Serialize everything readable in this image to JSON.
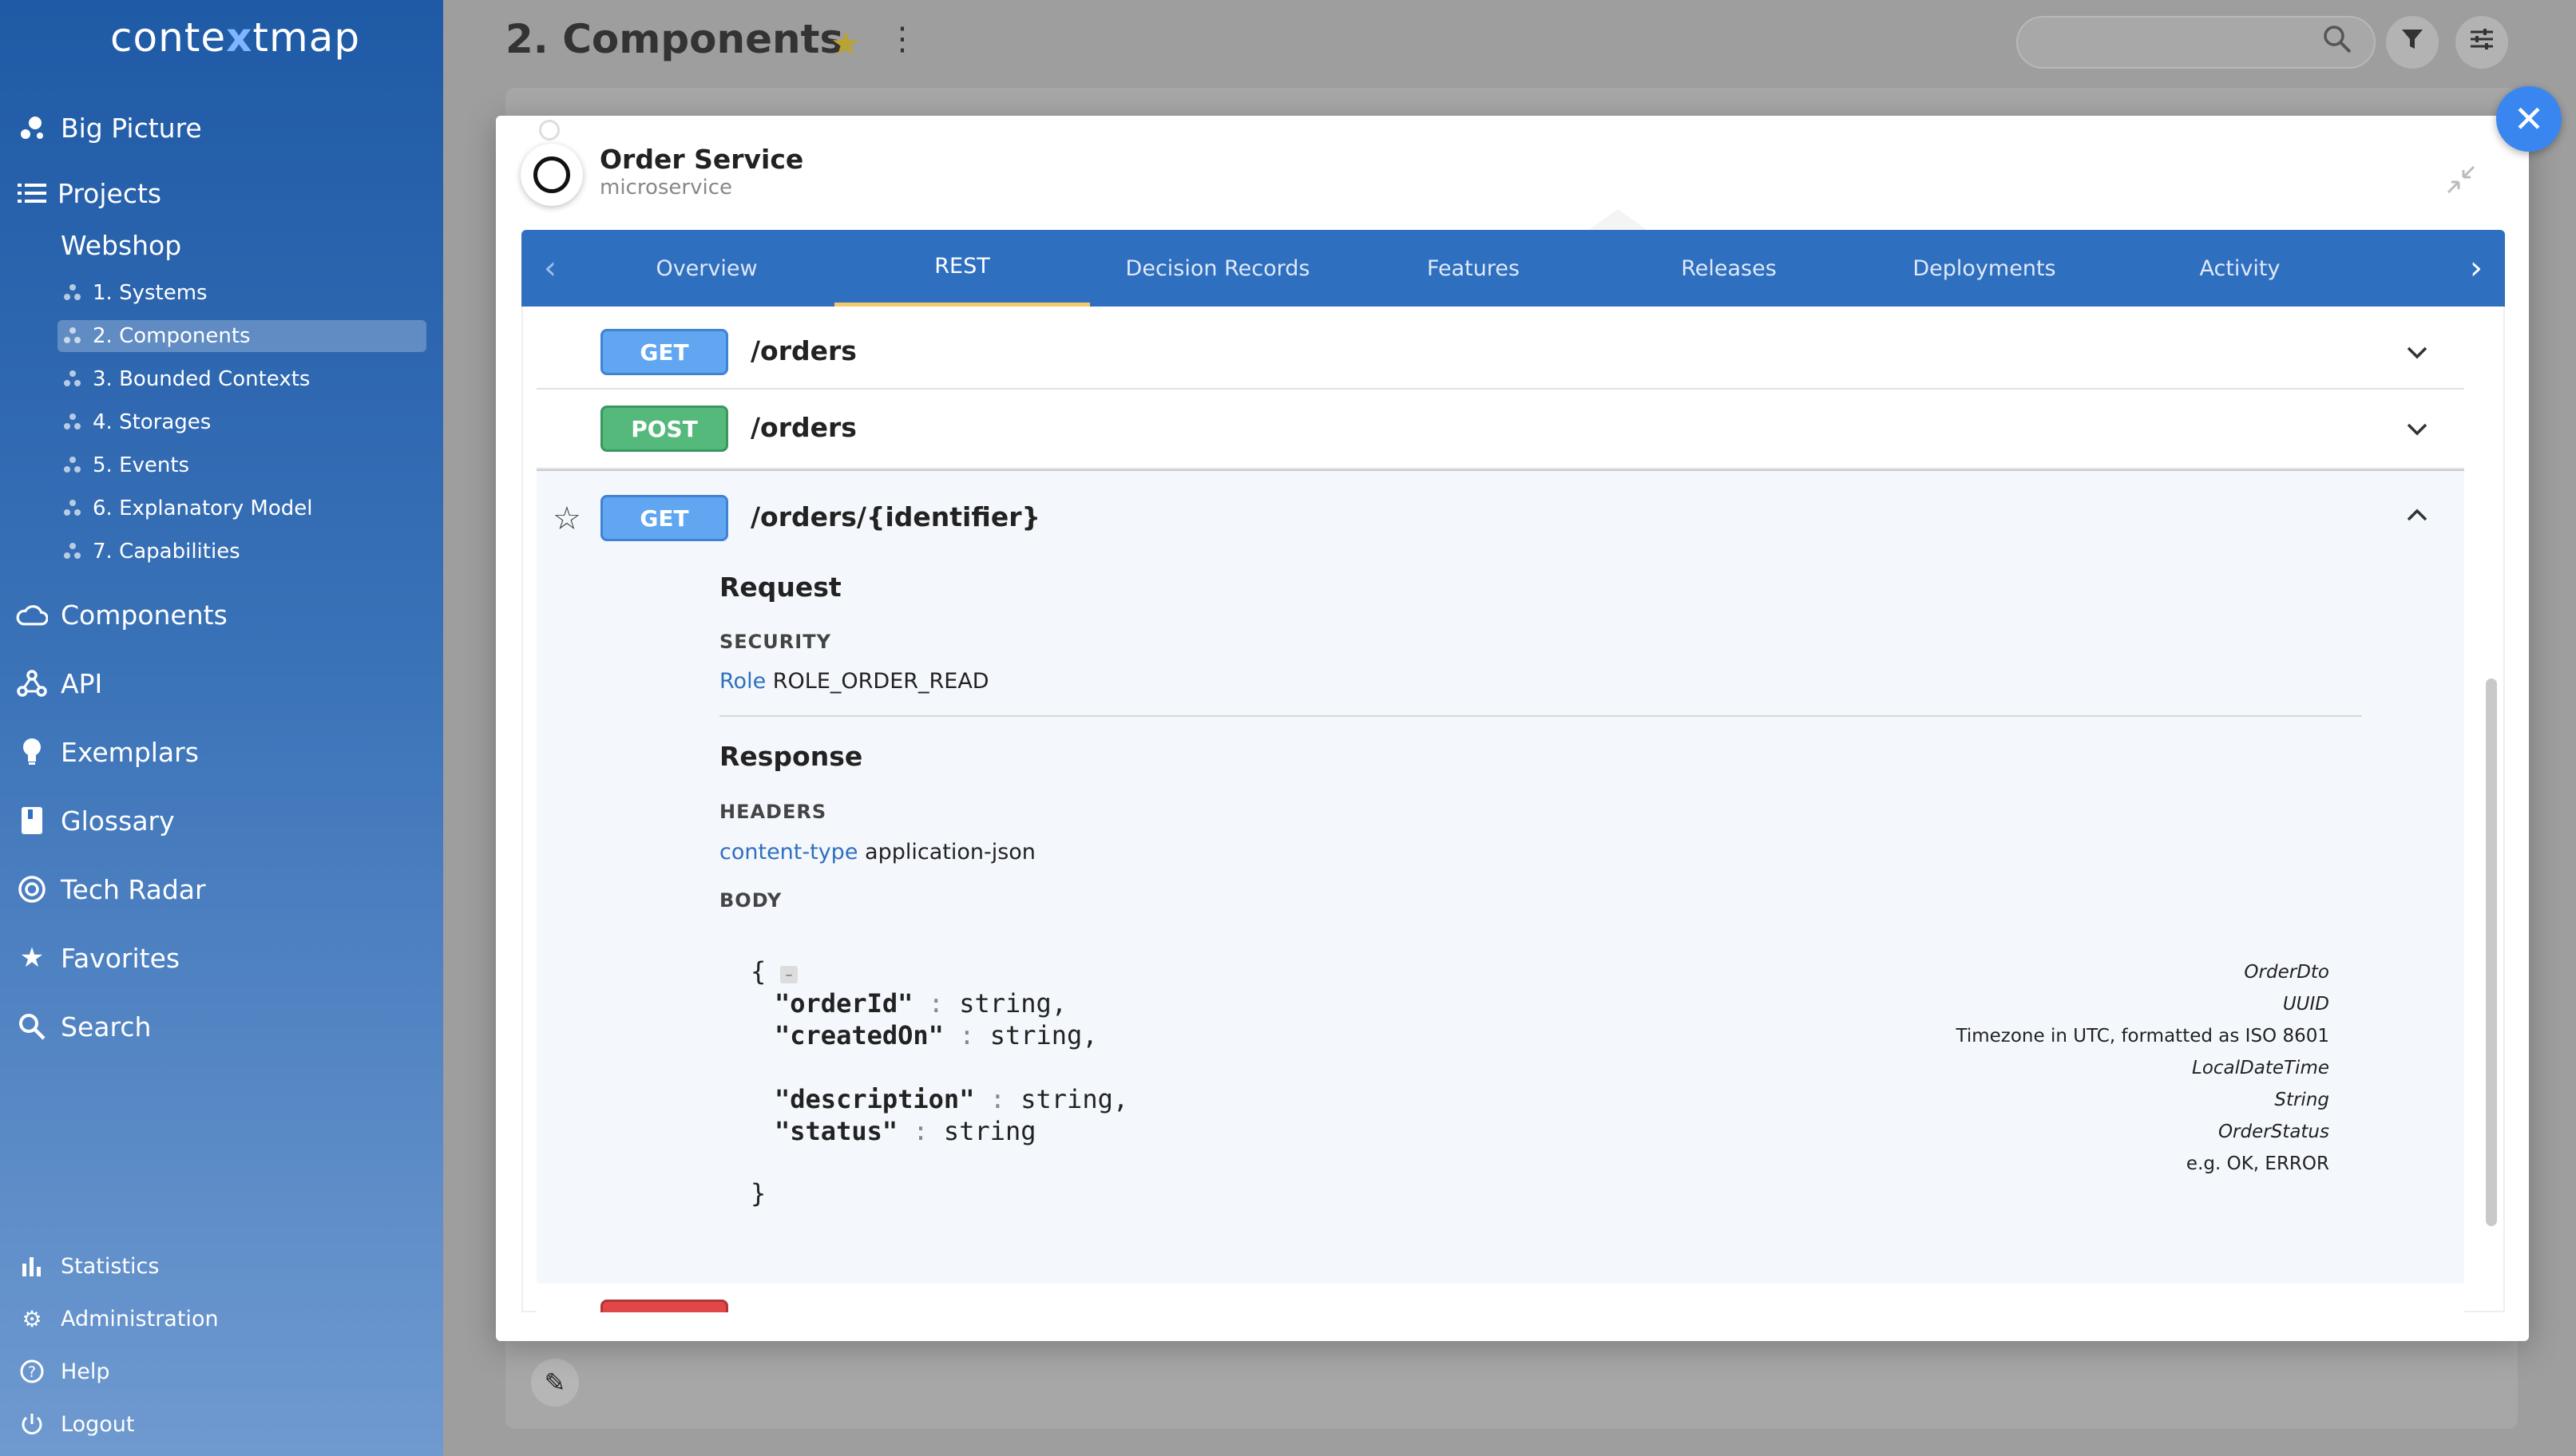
{
  "app": {
    "logo_left": "conte",
    "logo_x": "x",
    "logo_right": "tmap"
  },
  "sidebar": {
    "big_picture": "Big Picture",
    "projects": "Projects",
    "project_name": "Webshop",
    "sub_items": [
      {
        "label": "1. Systems"
      },
      {
        "label": "2. Components"
      },
      {
        "label": "3. Bounded Contexts"
      },
      {
        "label": "4. Storages"
      },
      {
        "label": "5. Events"
      },
      {
        "label": "6. Explanatory Model"
      },
      {
        "label": "7. Capabilities"
      }
    ],
    "main_items": [
      {
        "label": "Components",
        "icon": "cloud-icon"
      },
      {
        "label": "API",
        "icon": "webhook-icon"
      },
      {
        "label": "Exemplars",
        "icon": "lightbulb-icon"
      },
      {
        "label": "Glossary",
        "icon": "book-icon"
      },
      {
        "label": "Tech Radar",
        "icon": "radar-icon"
      },
      {
        "label": "Favorites",
        "icon": "star-icon"
      },
      {
        "label": "Search",
        "icon": "search-icon"
      }
    ],
    "bottom_items": [
      {
        "label": "Statistics",
        "icon": "bar-chart-icon"
      },
      {
        "label": "Administration",
        "icon": "gear-icon"
      },
      {
        "label": "Help",
        "icon": "help-icon"
      },
      {
        "label": "Logout",
        "icon": "power-icon"
      }
    ]
  },
  "header": {
    "title": "2. Components",
    "search_placeholder": ""
  },
  "modal": {
    "component_name": "Order Service",
    "component_type": "microservice",
    "tabs": [
      {
        "label": "Overview"
      },
      {
        "label": "REST"
      },
      {
        "label": "Decision Records"
      },
      {
        "label": "Features"
      },
      {
        "label": "Releases"
      },
      {
        "label": "Deployments"
      },
      {
        "label": "Activity"
      }
    ],
    "endpoints": [
      {
        "method": "GET",
        "path": "/orders"
      },
      {
        "method": "POST",
        "path": "/orders"
      },
      {
        "method": "GET",
        "path": "/orders/{identifier}"
      }
    ],
    "detail": {
      "request_heading": "Request",
      "security_label": "SECURITY",
      "role_key": "Role",
      "role_value": "ROLE_ORDER_READ",
      "response_heading": "Response",
      "headers_label": "HEADERS",
      "header_key": "content-type",
      "header_value": "application-json",
      "body_label": "BODY",
      "open_brace": "{",
      "close_brace": "}",
      "fold_symbol": "–",
      "fields": [
        {
          "key": "\"orderId\"",
          "type": "string,"
        },
        {
          "key": "\"createdOn\"",
          "type": "string,"
        },
        {
          "key": "\"description\"",
          "type": "string,"
        },
        {
          "key": "\"status\"",
          "type": "string"
        }
      ],
      "notes": [
        {
          "text": "OrderDto",
          "italic": true
        },
        {
          "text": "UUID",
          "italic": true
        },
        {
          "text": "Timezone in UTC, formatted as ISO 8601",
          "italic": false
        },
        {
          "text": "LocalDateTime",
          "italic": true
        },
        {
          "text": "String",
          "italic": true
        },
        {
          "text": "OrderStatus",
          "italic": true
        },
        {
          "text": "e.g. OK, ERROR",
          "italic": false
        }
      ]
    }
  },
  "colors": {
    "sidebar_top": "#1f5aa6",
    "tab_bar": "#2f6fbf",
    "tab_active_underline": "#f3c969",
    "get": "#61a6f1",
    "post": "#54b97a",
    "delete": "#e04848",
    "close_button": "#3a86f0"
  }
}
